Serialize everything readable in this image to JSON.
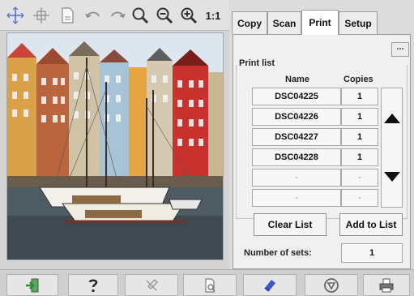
{
  "toolbar": {
    "items": [
      {
        "name": "crosshair-icon"
      },
      {
        "name": "move-icon"
      },
      {
        "name": "page-icon"
      },
      {
        "name": "rotate-left-icon"
      },
      {
        "name": "rotate-right-icon"
      },
      {
        "name": "zoom-fit-icon"
      },
      {
        "name": "zoom-out-icon"
      },
      {
        "name": "zoom-in-icon"
      }
    ],
    "actual_size_label": "1:1"
  },
  "tabs": [
    {
      "label": "Copy"
    },
    {
      "label": "Scan"
    },
    {
      "label": "Print",
      "active": true
    },
    {
      "label": "Setup"
    }
  ],
  "print_panel": {
    "more_label": "...",
    "print_list_label": "Print list",
    "col_name": "Name",
    "col_copies": "Copies",
    "rows": [
      {
        "name": "DSC04225",
        "copies": "1"
      },
      {
        "name": "DSC04226",
        "copies": "1"
      },
      {
        "name": "DSC04227",
        "copies": "1"
      },
      {
        "name": "DSC04228",
        "copies": "1"
      },
      {
        "name": "-",
        "copies": "-"
      },
      {
        "name": "-",
        "copies": "-"
      }
    ],
    "clear_list_label": "Clear List",
    "add_to_list_label": "Add to List",
    "number_of_sets_label": "Number of sets:",
    "number_of_sets_value": "1"
  },
  "bottom_bar": {
    "items": [
      {
        "name": "exit-icon"
      },
      {
        "name": "help-icon"
      },
      {
        "name": "disabled-tool-icon"
      },
      {
        "name": "preview-icon"
      },
      {
        "name": "eraser-icon"
      },
      {
        "name": "stop-icon"
      },
      {
        "name": "printer-icon"
      }
    ]
  },
  "colors": {
    "accent": "#2a39c9",
    "arrow": "#111111",
    "exit_icon": "#2f8a3a",
    "help_icon": "#2b2b2b"
  }
}
